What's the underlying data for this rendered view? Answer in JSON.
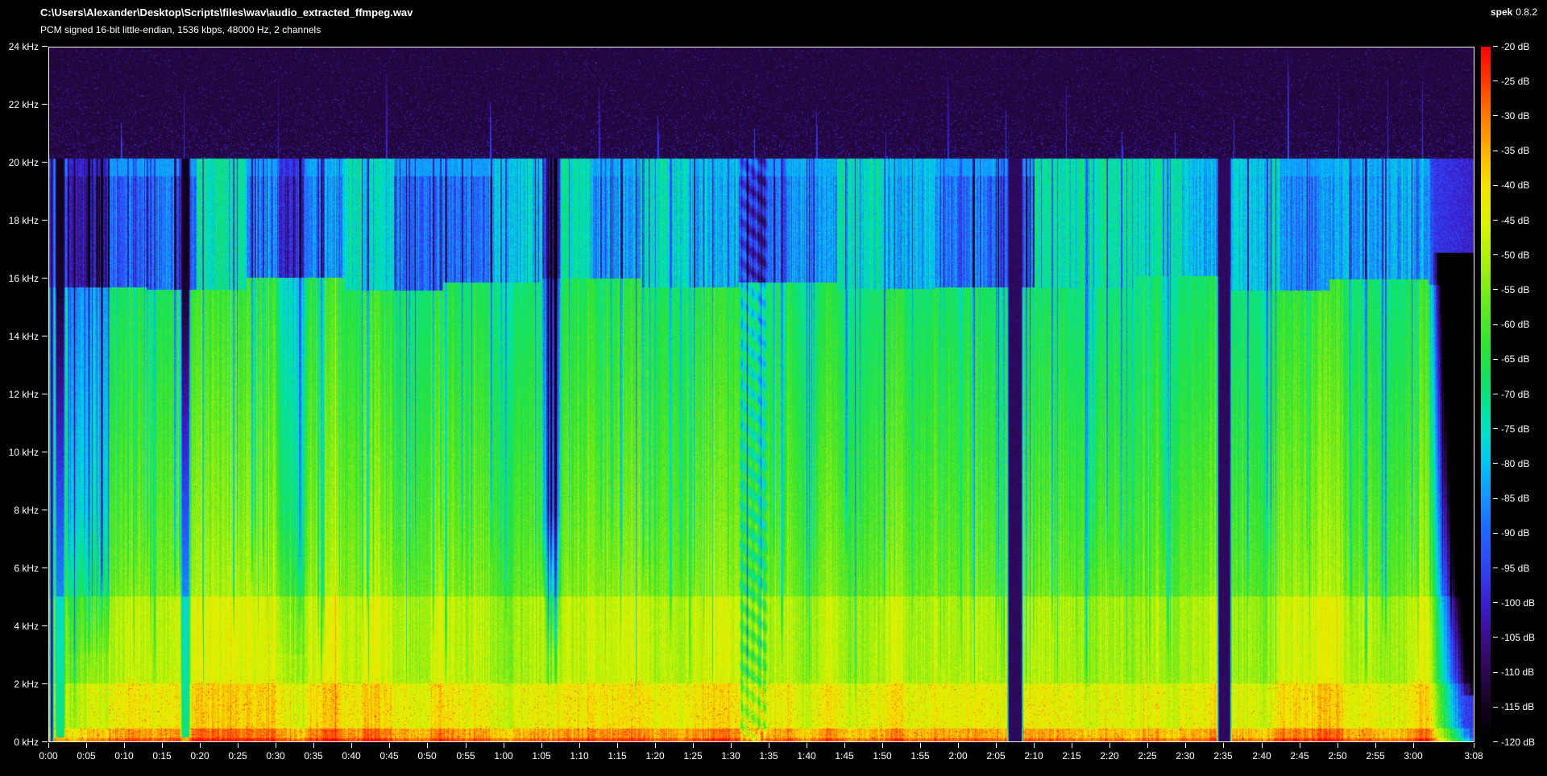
{
  "header": {
    "file_path": "C:\\Users\\Alexander\\Desktop\\Scripts\\files\\wav\\audio_extracted_ffmpeg.wav",
    "format_info": "PCM signed 16-bit little-endian, 1536 kbps, 48000 Hz, 2 channels",
    "app_name": "spek",
    "app_version": "0.8.2"
  },
  "axes": {
    "freq_max_khz": 24,
    "freq_tick_khz": [
      24,
      22,
      20,
      18,
      16,
      14,
      12,
      10,
      8,
      6,
      4,
      2,
      0
    ],
    "freq_labels": [
      "24 kHz",
      "22 kHz",
      "20 kHz",
      "18 kHz",
      "16 kHz",
      "14 kHz",
      "12 kHz",
      "10 kHz",
      "8 kHz",
      "6 kHz",
      "4 kHz",
      "2 kHz",
      "0 kHz"
    ],
    "duration_s": 188,
    "time_seconds": [
      0,
      5,
      10,
      15,
      20,
      25,
      30,
      35,
      40,
      45,
      50,
      55,
      60,
      65,
      70,
      75,
      80,
      85,
      90,
      95,
      100,
      105,
      110,
      115,
      120,
      125,
      130,
      135,
      140,
      145,
      150,
      155,
      160,
      165,
      170,
      175,
      180,
      188
    ],
    "time_labels": [
      "0:00",
      "0:05",
      "0:10",
      "0:15",
      "0:20",
      "0:25",
      "0:30",
      "0:35",
      "0:40",
      "0:45",
      "0:50",
      "0:55",
      "1:00",
      "1:05",
      "1:10",
      "1:15",
      "1:20",
      "1:25",
      "1:30",
      "1:35",
      "1:40",
      "1:45",
      "1:50",
      "1:55",
      "2:00",
      "2:05",
      "2:10",
      "2:15",
      "2:20",
      "2:25",
      "2:30",
      "2:35",
      "2:40",
      "2:45",
      "2:50",
      "2:55",
      "3:00",
      "3:08"
    ],
    "db_values": [
      -20,
      -25,
      -30,
      -35,
      -40,
      -45,
      -50,
      -55,
      -60,
      -65,
      -70,
      -75,
      -80,
      -85,
      -90,
      -95,
      -100,
      -105,
      -110,
      -115,
      -120
    ],
    "db_labels": [
      "-20 dB",
      "-25 dB",
      "-30 dB",
      "-35 dB",
      "-40 dB",
      "-45 dB",
      "-50 dB",
      "-55 dB",
      "-60 dB",
      "-65 dB",
      "-70 dB",
      "-75 dB",
      "-80 dB",
      "-85 dB",
      "-90 dB",
      "-95 dB",
      "-100 dB",
      "-105 dB",
      "-110 dB",
      "-115 dB",
      "-120 dB"
    ]
  },
  "palette": [
    [
      -120,
      "#000000"
    ],
    [
      -115,
      "#14031f"
    ],
    [
      -110,
      "#2b0850"
    ],
    [
      -105,
      "#3a0e8c"
    ],
    [
      -100,
      "#3b1fd0"
    ],
    [
      -95,
      "#2e45f2"
    ],
    [
      -90,
      "#2363ff"
    ],
    [
      -85,
      "#1593ff"
    ],
    [
      -80,
      "#00c4f0"
    ],
    [
      -76,
      "#00e0cf"
    ],
    [
      -72,
      "#05e49b"
    ],
    [
      -68,
      "#12e163"
    ],
    [
      -63,
      "#2ee336"
    ],
    [
      -58,
      "#5fe81f"
    ],
    [
      -52,
      "#9eef10"
    ],
    [
      -46,
      "#d8f403"
    ],
    [
      -40,
      "#f6e400"
    ],
    [
      -35,
      "#ffb400"
    ],
    [
      -30,
      "#ff7a00"
    ],
    [
      -25,
      "#ff3c00"
    ],
    [
      -20,
      "#ff0000"
    ]
  ],
  "spectrogram": {
    "lowpass_cutoff_khz": 20.15,
    "shelf_khz": 15.8,
    "noise_floor_db": -114,
    "events": [
      {
        "start": 0.0,
        "end": 0.7,
        "kind": "silence"
      },
      {
        "start": 0.7,
        "end": 2.2,
        "kind": "bass"
      },
      {
        "start": 2.2,
        "end": 8.0,
        "kind": "quiet",
        "low": 4,
        "high": 15
      },
      {
        "start": 17.3,
        "end": 18.7,
        "kind": "bass"
      },
      {
        "start": 30.0,
        "end": 34.0,
        "kind": "quiet",
        "low": 6,
        "high": 13
      },
      {
        "start": 65.3,
        "end": 67.6,
        "kind": "duck",
        "low": 2,
        "high": 26
      },
      {
        "start": 91.0,
        "end": 95.0,
        "kind": "dotted",
        "low": 8,
        "high": 18
      },
      {
        "start": 126.4,
        "end": 128.6,
        "kind": "silence"
      },
      {
        "start": 154.1,
        "end": 156.1,
        "kind": "silence"
      },
      {
        "start": 182.0,
        "end": 188.0,
        "kind": "fade"
      }
    ],
    "clicks": [
      9.5,
      17.8,
      30.2,
      44.5,
      58.2,
      72.5,
      80.3,
      93.0,
      101.2,
      110.4,
      118.6,
      126.2,
      134.2,
      141.5,
      148.5,
      156.3,
      163.4,
      170.1,
      176.6,
      181.2
    ]
  }
}
